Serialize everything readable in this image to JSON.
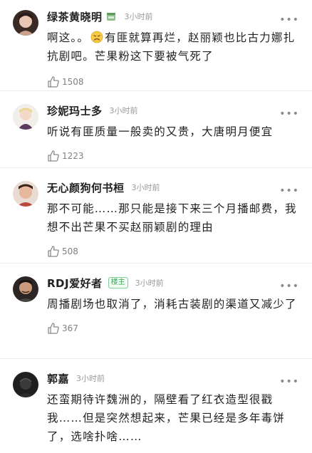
{
  "comments": [
    {
      "username": "绿茶黄晓明",
      "time": "3小时前",
      "text_before_emoji": "啊这。。",
      "text_after_emoji": "有匪就算再烂，赵丽颖也比古力娜扎抗剧吧。芒果粉这下要被气死了",
      "likes": "1508",
      "icons": [
        "badge-cup-icon",
        "sad-face-emoji-icon"
      ]
    },
    {
      "username": "珍妮玛士多",
      "time": "3小时前",
      "text": "听说有匪质量一般卖的又贵，大唐明月便宜",
      "likes": "1223"
    },
    {
      "username": "无心颜狗何书桓",
      "time": "3小时前",
      "text": "那不可能……那只能是接下来三个月播邮费，我想不出芒果不买赵丽颖剧的理由",
      "likes": "508"
    },
    {
      "username": "RDJ爱好者",
      "op_tag": "楼主",
      "time": "3小时前",
      "text": "周播剧场也取消了，消耗古装剧的渠道又减少了",
      "likes": "367"
    },
    {
      "username": "郭嘉",
      "time": "3小时前",
      "text": "还蛮期待许魏洲的，隔壁看了红衣造型很戳我……但是突然想起来，芒果已经是多年毒饼了，选啥扑啥……",
      "likes": ""
    }
  ],
  "more_glyph": "•••",
  "colors": {
    "username": "#222222",
    "time": "#9a9a9a",
    "op_tag": "#3aa757",
    "divider": "#ececec"
  }
}
